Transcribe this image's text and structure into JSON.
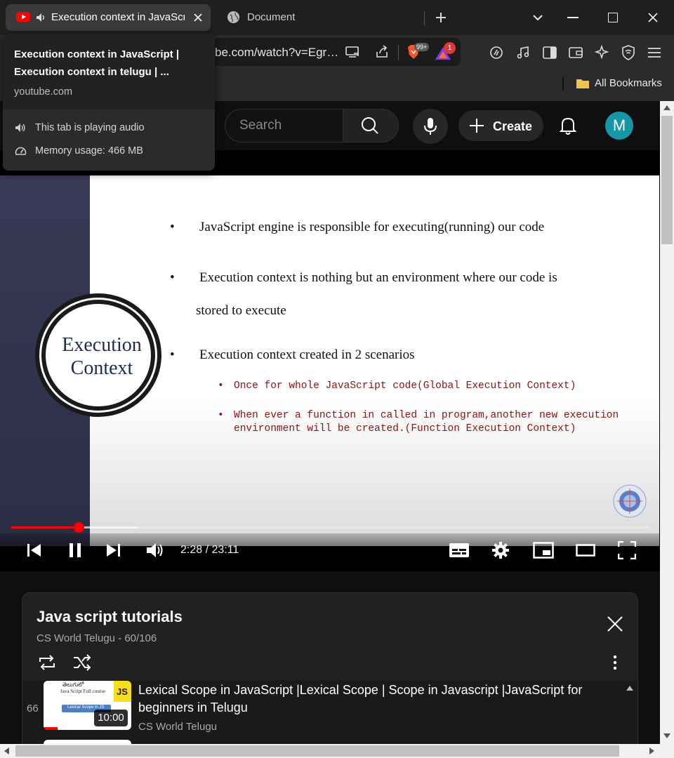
{
  "browser": {
    "active_tab_title": "Execution context in JavaScr",
    "second_tab_title": "Document",
    "url": "be.com/watch?v=Egr…",
    "shield_badge": "99+",
    "rewards_badge": "1",
    "bookmarks_label": "All Bookmarks"
  },
  "hover_card": {
    "title_line1": "Execution context in JavaScript |",
    "title_line2": "Execution context in telugu | ...",
    "domain": "youtube.com",
    "audio_text": "This tab is playing audio",
    "memory_text": "Memory usage: 466 MB"
  },
  "header": {
    "search_placeholder": "Search",
    "create_label": "Create",
    "avatar_letter": "M"
  },
  "slide": {
    "bullet": "•",
    "point1": "JavaScript engine is responsible for executing(running) our code",
    "point2_line1": "Execution context is nothing but an environment where our code is",
    "point2_line2": "stored to execute",
    "point3": "Execution context created in 2 scenarios",
    "sub1": "Once for whole JavaScript code(Global Execution Context)",
    "sub2_line1": "When ever a function in called in program,another new execution",
    "sub2_line2": "environment will be created.(Function Execution Context)",
    "circle_line1": "Execution",
    "circle_line2": "Context"
  },
  "player": {
    "time": "2:28 / 23:11",
    "played_fraction": 0.106
  },
  "playlist": {
    "title": "Java script tutorials",
    "subtitle": "CS World Telugu - 60/106",
    "item": {
      "index": "66",
      "title_line1": "Lexical Scope in JavaScript |Lexical Scope | Scope in Javascript |JavaScript for",
      "title_line2": "beginners in Telugu",
      "channel": "CS World Telugu",
      "duration": "10:00",
      "thumb_top": "తెలుగులో",
      "thumb_mid": "Java Script Full course",
      "thumb_badge": "JS",
      "thumb_label": "Lexical Scope in JS"
    }
  },
  "colors": {
    "accent_red": "#ff0000",
    "avatar_bg": "#1597a6",
    "code_red": "#8a1313"
  }
}
